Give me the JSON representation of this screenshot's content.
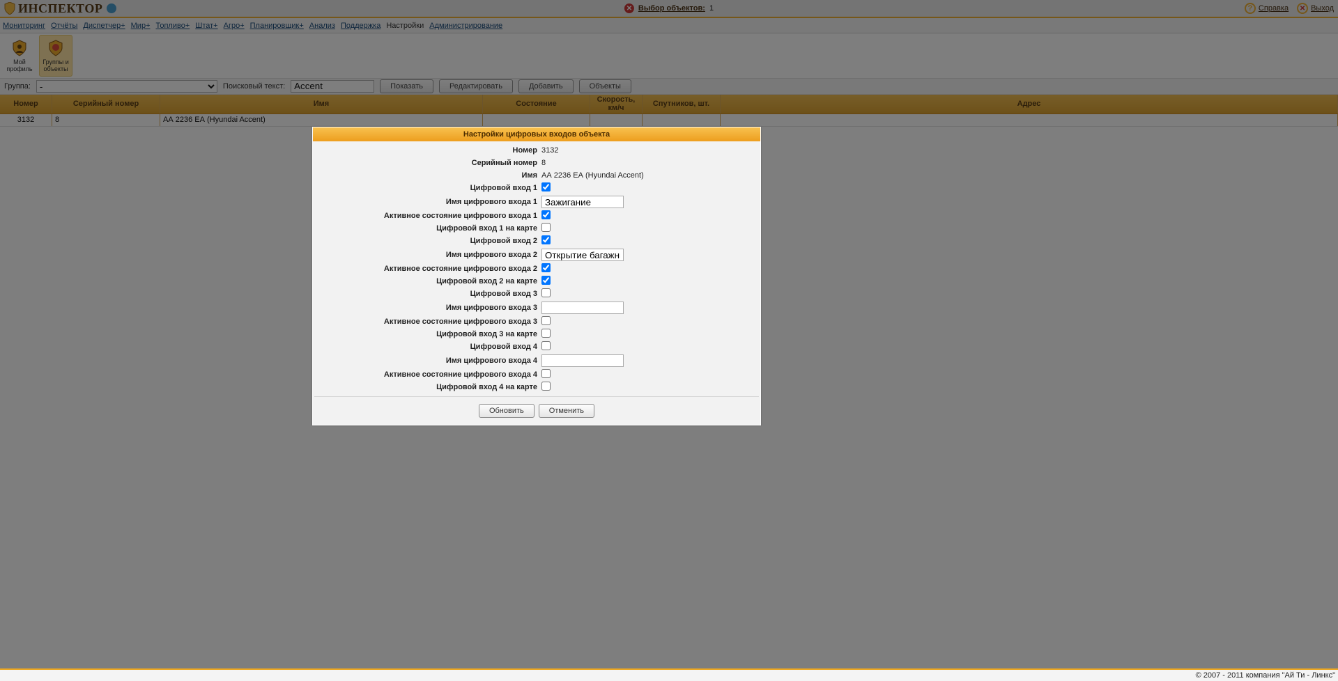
{
  "brand": "ИНСПЕКТОР",
  "topbar": {
    "selection_label": "Выбор объектов:",
    "selection_count": "1",
    "help": "Справка",
    "exit": "Выход"
  },
  "menu": {
    "items": [
      "Мониторинг",
      "Отчёты",
      "Диспетчер+",
      "Мир+",
      "Топливо+",
      "Штат+",
      "Агро+",
      "Планировщик+",
      "Анализ",
      "Поддержка",
      "Настройки",
      "Администрирование"
    ]
  },
  "tools": {
    "profile": "Мой профиль",
    "groups": "Группы и объекты"
  },
  "filter": {
    "group_label": "Группа:",
    "group_value": "-",
    "search_label": "Поисковый текст:",
    "search_value": "Accent",
    "show": "Показать",
    "edit": "Редактировать",
    "add": "Добавить",
    "objects": "Объекты"
  },
  "table": {
    "headers": {
      "num": "Номер",
      "ser": "Серийный номер",
      "name": "Имя",
      "state": "Состояние",
      "speed": "Скорость, км/ч",
      "sat": "Спутников, шт.",
      "addr": "Адрес"
    },
    "row": {
      "num": "3132",
      "ser": "8",
      "name": "АА 2236 ЕА (Hyundai Accent)"
    }
  },
  "dialog": {
    "title": "Настройки цифровых входов объекта",
    "labels": {
      "num": "Номер",
      "ser": "Серийный номер",
      "name": "Имя",
      "in1": "Цифровой вход 1",
      "in1_name": "Имя цифрового входа 1",
      "in1_active": "Активное состояние цифрового входа 1",
      "in1_map": "Цифровой вход 1 на карте",
      "in2": "Цифровой вход 2",
      "in2_name": "Имя цифрового входа 2",
      "in2_active": "Активное состояние цифрового входа 2",
      "in2_map": "Цифровой вход 2 на карте",
      "in3": "Цифровой вход 3",
      "in3_name": "Имя цифрового входа 3",
      "in3_active": "Активное состояние цифрового входа 3",
      "in3_map": "Цифровой вход 3 на карте",
      "in4": "Цифровой вход 4",
      "in4_name": "Имя цифрового входа 4",
      "in4_active": "Активное состояние цифрового входа 4",
      "in4_map": "Цифровой вход 4 на карте"
    },
    "values": {
      "num": "3132",
      "ser": "8",
      "name": "АА 2236 ЕА (Hyundai Accent)",
      "in1": true,
      "in1_name": "Зажигание",
      "in1_active": true,
      "in1_map": false,
      "in2": true,
      "in2_name": "Открытие багажника",
      "in2_active": true,
      "in2_map": true,
      "in3": false,
      "in3_name": "",
      "in3_active": false,
      "in3_map": false,
      "in4": false,
      "in4_name": "",
      "in4_active": false,
      "in4_map": false
    },
    "buttons": {
      "update": "Обновить",
      "cancel": "Отменить"
    }
  },
  "footer": "© 2007 - 2011 компания \"Ай Ти - Линкс\""
}
